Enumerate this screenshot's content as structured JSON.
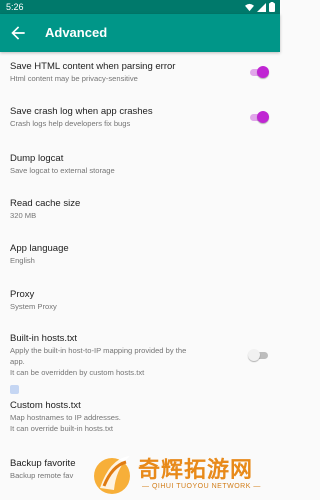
{
  "status_bar": {
    "time": "5:26",
    "icons": [
      "wifi-icon",
      "signal-icon",
      "battery-icon"
    ]
  },
  "app_bar": {
    "title": "Advanced",
    "back_icon": "arrow-back-icon"
  },
  "settings": [
    {
      "title": "Save HTML content when parsing error",
      "summary": [
        "Html content may be privacy-sensitive"
      ],
      "switch": true
    },
    {
      "title": "Save crash log when app crashes",
      "summary": [
        "Crash logs help developers fix bugs"
      ],
      "switch": true
    },
    {
      "title": "Dump logcat",
      "summary": [
        "Save logcat to external storage"
      ]
    },
    {
      "title": "Read cache size",
      "summary": [
        "320 MB"
      ]
    },
    {
      "title": "App language",
      "summary": [
        "English"
      ]
    },
    {
      "title": "Proxy",
      "summary": [
        "System Proxy"
      ]
    },
    {
      "title": "Built-in hosts.txt",
      "summary": [
        "Apply the built-in host-to-IP mapping provided by the",
        "app.",
        "It can be overridden by custom hosts.txt"
      ],
      "switch": false
    },
    {
      "title": "Custom hosts.txt",
      "summary": [
        "Map hostnames to IP addresses.",
        "It can override built-in hosts.txt"
      ]
    },
    {
      "title": "Backup favorite",
      "summary": [
        "Backup remote fav"
      ]
    }
  ],
  "watermark": {
    "text_cn": "奇辉拓游网",
    "text_en": "— QIHUI TUOYOU NETWORK —"
  },
  "colors": {
    "status_bar": "#00796b",
    "app_bar": "#009688",
    "accent": "#c026d3",
    "watermark": "#e88a1a"
  }
}
